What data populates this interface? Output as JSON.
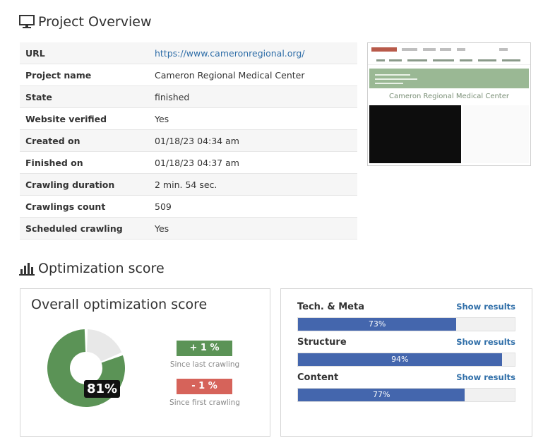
{
  "overview": {
    "heading": "Project Overview",
    "heading_icon": "monitor-icon",
    "rows": [
      {
        "label": "URL",
        "value": "https://www.cameronregional.org/"
      },
      {
        "label": "Project name",
        "value": "Cameron Regional Medical Center"
      },
      {
        "label": "State",
        "value": "finished"
      },
      {
        "label": "Website verified",
        "value": "Yes"
      },
      {
        "label": "Created on",
        "value": "01/18/23 04:34 am"
      },
      {
        "label": "Finished on",
        "value": "01/18/23 04:37 am"
      },
      {
        "label": "Crawling duration",
        "value": "2 min. 54 sec."
      },
      {
        "label": "Crawlings count",
        "value": "509"
      },
      {
        "label": "Scheduled crawling",
        "value": "Yes"
      }
    ],
    "thumbnail": {
      "title": "Cameron Regional Medical Center"
    }
  },
  "score": {
    "heading": "Optimization score",
    "heading_icon": "bar-chart-icon",
    "overall": {
      "title": "Overall optimization score",
      "value_label": "81%",
      "value": 0.81,
      "fill_color": "#5b9356",
      "rest_color": "#e8e8e8",
      "since_last": {
        "label": "+ 1 %",
        "caption": "Since last crawling",
        "color": "#5b9356"
      },
      "since_first": {
        "label": "- 1 %",
        "caption": "Since first crawling",
        "color": "#d6635a"
      }
    },
    "categories": [
      {
        "name": "Tech. & Meta",
        "link": "Show results",
        "percent_label": "73%",
        "value": 0.73
      },
      {
        "name": "Structure",
        "link": "Show results",
        "percent_label": "94%",
        "value": 0.94
      },
      {
        "name": "Content",
        "link": "Show results",
        "percent_label": "77%",
        "value": 0.77
      }
    ],
    "bar_color": "#4466ad"
  }
}
